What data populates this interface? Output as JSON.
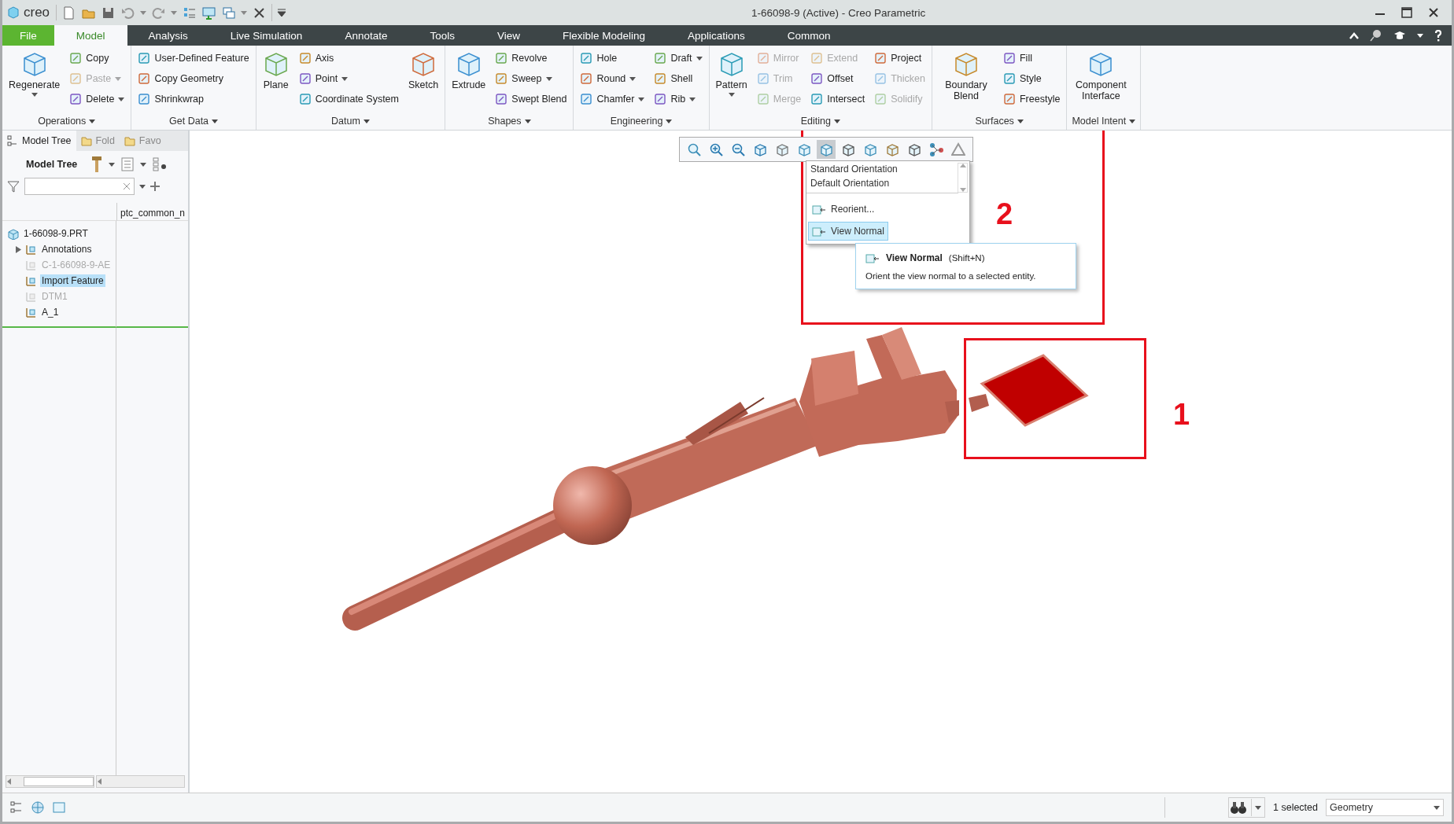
{
  "window": {
    "logo": "creo",
    "title": "1-66098-9 (Active) - Creo Parametric"
  },
  "ribbon_tabs": [
    {
      "label": "File",
      "kind": "file",
      "selected": false
    },
    {
      "label": "Model",
      "kind": "tab",
      "selected": true
    },
    {
      "label": "Analysis",
      "kind": "tab",
      "selected": false
    },
    {
      "label": "Live Simulation",
      "kind": "tab",
      "selected": false
    },
    {
      "label": "Annotate",
      "kind": "tab",
      "selected": false
    },
    {
      "label": "Tools",
      "kind": "tab",
      "selected": false
    },
    {
      "label": "View",
      "kind": "tab",
      "selected": false
    },
    {
      "label": "Flexible Modeling",
      "kind": "tab",
      "selected": false
    },
    {
      "label": "Applications",
      "kind": "tab",
      "selected": false
    },
    {
      "label": "Common",
      "kind": "tab",
      "selected": false
    }
  ],
  "ribbon_groups": [
    {
      "label": "Operations",
      "columns": [
        {
          "kind": "large",
          "items": [
            {
              "label": "Regenerate",
              "dropdown": true,
              "disabled": false
            }
          ]
        },
        {
          "kind": "small",
          "items": [
            {
              "label": "Copy",
              "dropdown": false,
              "disabled": false
            },
            {
              "label": "Paste",
              "dropdown": true,
              "disabled": true
            },
            {
              "label": "Delete",
              "dropdown": true,
              "disabled": false
            }
          ]
        }
      ]
    },
    {
      "label": "Get Data",
      "columns": [
        {
          "kind": "small",
          "items": [
            {
              "label": "User-Defined Feature",
              "dropdown": false,
              "disabled": false
            },
            {
              "label": "Copy Geometry",
              "dropdown": false,
              "disabled": false
            },
            {
              "label": "Shrinkwrap",
              "dropdown": false,
              "disabled": false
            }
          ]
        }
      ]
    },
    {
      "label": "Datum",
      "columns": [
        {
          "kind": "large",
          "items": [
            {
              "label": "Plane",
              "dropdown": false,
              "disabled": false
            }
          ]
        },
        {
          "kind": "small",
          "items": [
            {
              "label": "Axis",
              "dropdown": false,
              "disabled": false
            },
            {
              "label": "Point",
              "dropdown": true,
              "disabled": false
            },
            {
              "label": "Coordinate System",
              "dropdown": false,
              "disabled": false
            }
          ]
        },
        {
          "kind": "large",
          "items": [
            {
              "label": "Sketch",
              "dropdown": false,
              "disabled": false
            }
          ]
        }
      ]
    },
    {
      "label": "Shapes",
      "columns": [
        {
          "kind": "large",
          "items": [
            {
              "label": "Extrude",
              "dropdown": false,
              "disabled": false
            }
          ]
        },
        {
          "kind": "small",
          "items": [
            {
              "label": "Revolve",
              "dropdown": false,
              "disabled": false
            },
            {
              "label": "Sweep",
              "dropdown": true,
              "disabled": false
            },
            {
              "label": "Swept Blend",
              "dropdown": false,
              "disabled": false
            }
          ]
        }
      ]
    },
    {
      "label": "Engineering",
      "columns": [
        {
          "kind": "small",
          "items": [
            {
              "label": "Hole",
              "dropdown": false,
              "disabled": false
            },
            {
              "label": "Round",
              "dropdown": true,
              "disabled": false
            },
            {
              "label": "Chamfer",
              "dropdown": true,
              "disabled": false
            }
          ]
        },
        {
          "kind": "small",
          "items": [
            {
              "label": "Draft",
              "dropdown": true,
              "disabled": false
            },
            {
              "label": "Shell",
              "dropdown": false,
              "disabled": false
            },
            {
              "label": "Rib",
              "dropdown": true,
              "disabled": false
            }
          ]
        }
      ]
    },
    {
      "label": "Editing",
      "columns": [
        {
          "kind": "large",
          "items": [
            {
              "label": "Pattern",
              "dropdown": true,
              "disabled": false
            }
          ]
        },
        {
          "kind": "small",
          "items": [
            {
              "label": "Mirror",
              "dropdown": false,
              "disabled": true
            },
            {
              "label": "Trim",
              "dropdown": false,
              "disabled": true
            },
            {
              "label": "Merge",
              "dropdown": false,
              "disabled": true
            }
          ]
        },
        {
          "kind": "small",
          "items": [
            {
              "label": "Extend",
              "dropdown": false,
              "disabled": true
            },
            {
              "label": "Offset",
              "dropdown": false,
              "disabled": false
            },
            {
              "label": "Intersect",
              "dropdown": false,
              "disabled": false
            }
          ]
        },
        {
          "kind": "small",
          "items": [
            {
              "label": "Project",
              "dropdown": false,
              "disabled": false
            },
            {
              "label": "Thicken",
              "dropdown": false,
              "disabled": true
            },
            {
              "label": "Solidify",
              "dropdown": false,
              "disabled": true
            }
          ]
        }
      ]
    },
    {
      "label": "Surfaces",
      "columns": [
        {
          "kind": "large",
          "items": [
            {
              "label": "Boundary Blend",
              "dropdown": false,
              "disabled": false
            }
          ]
        },
        {
          "kind": "small",
          "items": [
            {
              "label": "Fill",
              "dropdown": false,
              "disabled": false
            },
            {
              "label": "Style",
              "dropdown": false,
              "disabled": false
            },
            {
              "label": "Freestyle",
              "dropdown": false,
              "disabled": false
            }
          ]
        }
      ]
    },
    {
      "label": "Model Intent",
      "columns": [
        {
          "kind": "large",
          "items": [
            {
              "label": "Component Interface",
              "dropdown": false,
              "disabled": false
            }
          ]
        }
      ]
    }
  ],
  "model_tree": {
    "tabs": [
      {
        "label": "Model Tree",
        "selected": true
      },
      {
        "label": "Fold",
        "selected": false
      },
      {
        "label": "Favo",
        "selected": false
      }
    ],
    "title": "Model Tree",
    "column_header": "ptc_common_n",
    "items": [
      {
        "label": "1-66098-9.PRT",
        "selected": false,
        "dimmed": false,
        "children": [
          {
            "label": "Annotations",
            "selected": false,
            "dimmed": false,
            "expanded": false
          },
          {
            "label": "C-1-66098-9-AE",
            "selected": false,
            "dimmed": true
          },
          {
            "label": "Import Feature",
            "selected": true,
            "dimmed": false
          },
          {
            "label": "DTM1",
            "selected": false,
            "dimmed": true
          },
          {
            "label": "A_1",
            "selected": false,
            "dimmed": false
          }
        ]
      }
    ]
  },
  "view_toolbar": {
    "buttons": [
      {
        "selected": false
      },
      {
        "selected": false
      },
      {
        "selected": false
      },
      {
        "selected": false
      },
      {
        "selected": false
      },
      {
        "selected": false
      },
      {
        "selected": true
      },
      {
        "selected": false
      },
      {
        "selected": false
      },
      {
        "selected": false
      },
      {
        "selected": false
      },
      {
        "selected": false
      },
      {
        "selected": false
      }
    ]
  },
  "orientation_menu": {
    "items": [
      {
        "label": "Standard Orientation",
        "kind": "view",
        "selected": false
      },
      {
        "label": "Default Orientation",
        "kind": "view",
        "selected": false
      },
      {
        "label": "Reorient...",
        "kind": "command",
        "selected": false
      },
      {
        "label": "View Normal",
        "kind": "command",
        "selected": true
      }
    ]
  },
  "tooltip": {
    "title": "View Normal",
    "shortcut": "(Shift+N)",
    "description": "Orient the view normal to a selected entity."
  },
  "callouts": [
    {
      "label": "1"
    },
    {
      "label": "2"
    }
  ],
  "status_bar": {
    "selection": "1 selected",
    "filter": "Geometry"
  }
}
